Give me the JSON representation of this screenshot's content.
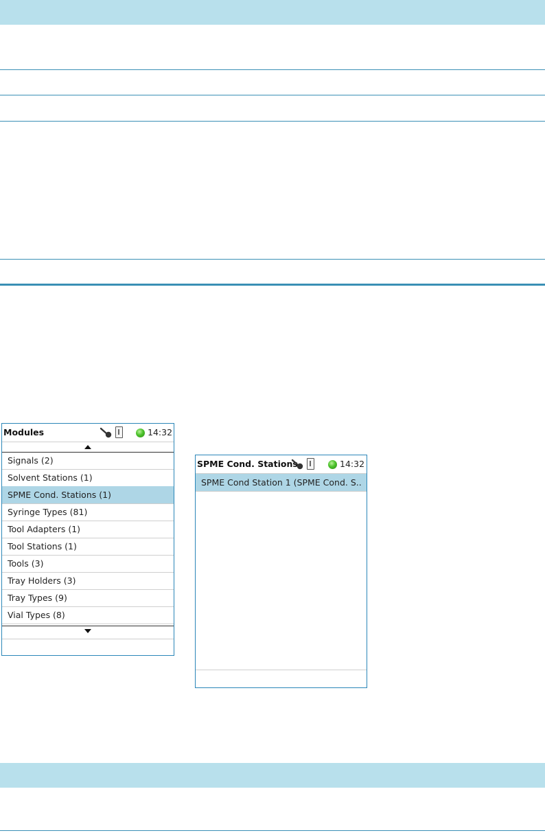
{
  "colors": {
    "band": "#b8e0ec",
    "rule": "#3a8fb5",
    "screen_border": "#2a86b8",
    "selected_row": "#aed6e6",
    "status_led": "#4cc22b"
  },
  "modules_screen": {
    "title": "Modules",
    "time": "14:32",
    "icons": [
      "key-icon",
      "usb-icon",
      "status-led-icon",
      "scroll-up-icon",
      "scroll-down-icon"
    ],
    "items": [
      {
        "label": "Signals (2)",
        "selected": false
      },
      {
        "label": "Solvent Stations (1)",
        "selected": false
      },
      {
        "label": "SPME Cond. Stations (1)",
        "selected": true
      },
      {
        "label": "Syringe Types (81)",
        "selected": false
      },
      {
        "label": "Tool Adapters (1)",
        "selected": false
      },
      {
        "label": "Tool Stations (1)",
        "selected": false
      },
      {
        "label": "Tools (3)",
        "selected": false
      },
      {
        "label": "Tray Holders (3)",
        "selected": false
      },
      {
        "label": "Tray Types (9)",
        "selected": false
      },
      {
        "label": "Vial Types (8)",
        "selected": false
      }
    ]
  },
  "spme_screen": {
    "title": "SPME Cond. Stations",
    "time": "14:32",
    "icons": [
      "key-icon",
      "usb-icon",
      "status-led-icon"
    ],
    "items": [
      {
        "label": "SPME Cond Station 1 (SPME Cond. S..",
        "selected": true
      }
    ]
  }
}
